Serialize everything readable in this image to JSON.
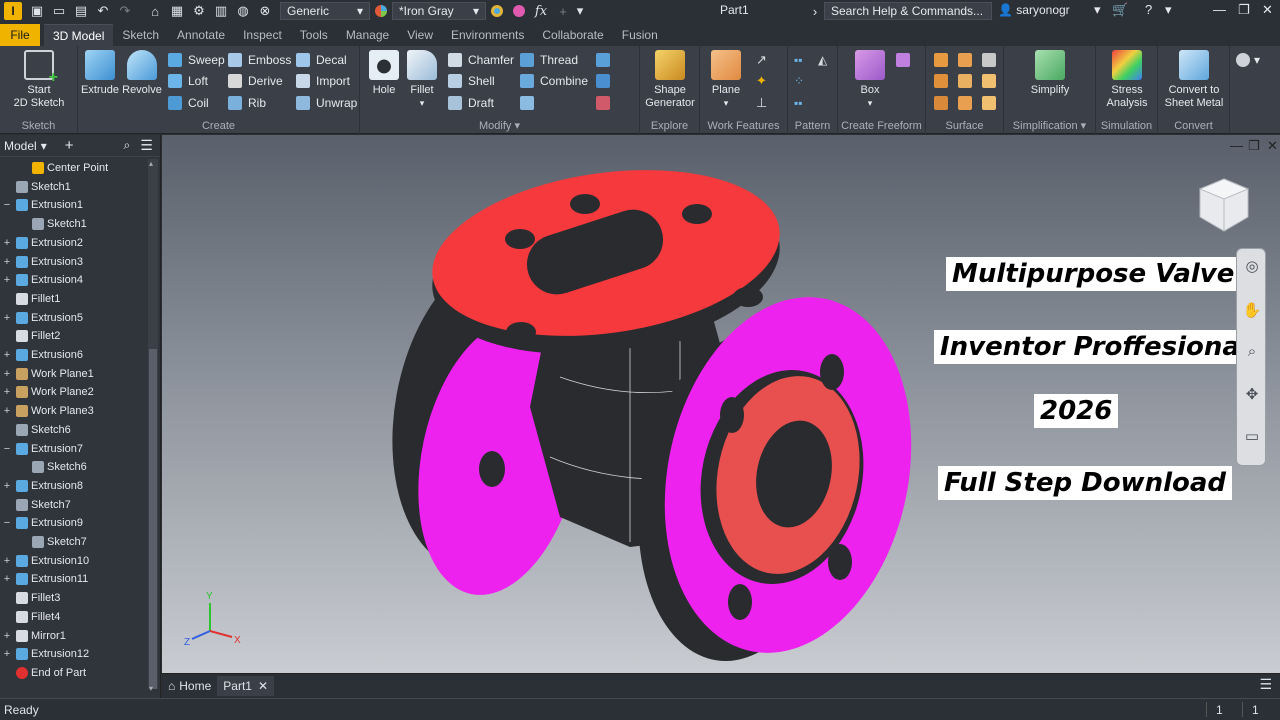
{
  "titlebar": {
    "app_icon": "I",
    "material_combo": "Generic",
    "appearance_combo": "*Iron Gray",
    "document_title": "Part1",
    "search_placeholder": "Search Help & Commands...",
    "user_name": "saryonogr"
  },
  "ribbon_tabs": [
    "File",
    "3D Model",
    "Sketch",
    "Annotate",
    "Inspect",
    "Tools",
    "Manage",
    "View",
    "Environments",
    "Collaborate",
    "Fusion"
  ],
  "active_tab": "3D Model",
  "ribbon": {
    "sketch_panel": {
      "label": "Sketch",
      "start_sketch": "Start\n2D Sketch"
    },
    "create_panel": {
      "label": "Create",
      "extrude": "Extrude",
      "revolve": "Revolve",
      "sweep": "Sweep",
      "loft": "Loft",
      "coil": "Coil",
      "emboss": "Emboss",
      "derive": "Derive",
      "rib": "Rib",
      "decal": "Decal",
      "import": "Import",
      "unwrap": "Unwrap"
    },
    "modify_panel": {
      "label": "Modify",
      "hole": "Hole",
      "fillet": "Fillet",
      "chamfer": "Chamfer",
      "shell": "Shell",
      "draft": "Draft",
      "thread": "Thread",
      "combine": "Combine"
    },
    "explore_panel": {
      "label": "Explore",
      "shape_generator": "Shape\nGenerator"
    },
    "work_features_panel": {
      "label": "Work Features",
      "plane": "Plane"
    },
    "pattern_panel": {
      "label": "Pattern"
    },
    "freeform_panel": {
      "label": "Create Freeform",
      "box": "Box"
    },
    "surface_panel": {
      "label": "Surface"
    },
    "simplification_panel": {
      "label": "Simplification",
      "simplify": "Simplify"
    },
    "simulation_panel": {
      "label": "Simulation",
      "stress": "Stress\nAnalysis"
    },
    "convert_panel": {
      "label": "Convert",
      "sheet_metal": "Convert to\nSheet Metal"
    }
  },
  "browser": {
    "title": "Model",
    "items": [
      {
        "label": "Center Point",
        "expander": "",
        "indent": 2,
        "icon": "point-icon"
      },
      {
        "label": "Sketch1",
        "expander": "",
        "indent": 1,
        "icon": "sketch-icon"
      },
      {
        "label": "Extrusion1",
        "expander": "−",
        "indent": 1,
        "icon": "extrude-icon"
      },
      {
        "label": "Sketch1",
        "expander": "",
        "indent": 2,
        "icon": "sketch-icon"
      },
      {
        "label": "Extrusion2",
        "expander": "+",
        "indent": 1,
        "icon": "extrude-icon"
      },
      {
        "label": "Extrusion3",
        "expander": "+",
        "indent": 1,
        "icon": "extrude-icon"
      },
      {
        "label": "Extrusion4",
        "expander": "+",
        "indent": 1,
        "icon": "extrude-icon"
      },
      {
        "label": "Fillet1",
        "expander": "",
        "indent": 1,
        "icon": "fillet-icon"
      },
      {
        "label": "Extrusion5",
        "expander": "+",
        "indent": 1,
        "icon": "extrude-icon"
      },
      {
        "label": "Fillet2",
        "expander": "",
        "indent": 1,
        "icon": "fillet-icon"
      },
      {
        "label": "Extrusion6",
        "expander": "+",
        "indent": 1,
        "icon": "extrude-icon"
      },
      {
        "label": "Work Plane1",
        "expander": "+",
        "indent": 1,
        "icon": "workplane-icon"
      },
      {
        "label": "Work Plane2",
        "expander": "+",
        "indent": 1,
        "icon": "workplane-icon"
      },
      {
        "label": "Work Plane3",
        "expander": "+",
        "indent": 1,
        "icon": "workplane-icon"
      },
      {
        "label": "Sketch6",
        "expander": "",
        "indent": 1,
        "icon": "sketch-icon"
      },
      {
        "label": "Extrusion7",
        "expander": "−",
        "indent": 1,
        "icon": "extrude-icon"
      },
      {
        "label": "Sketch6",
        "expander": "",
        "indent": 2,
        "icon": "sketch-icon"
      },
      {
        "label": "Extrusion8",
        "expander": "+",
        "indent": 1,
        "icon": "extrude-icon"
      },
      {
        "label": "Sketch7",
        "expander": "",
        "indent": 1,
        "icon": "sketch-icon"
      },
      {
        "label": "Extrusion9",
        "expander": "−",
        "indent": 1,
        "icon": "extrude-icon"
      },
      {
        "label": "Sketch7",
        "expander": "",
        "indent": 2,
        "icon": "sketch-icon"
      },
      {
        "label": "Extrusion10",
        "expander": "+",
        "indent": 1,
        "icon": "extrude-icon"
      },
      {
        "label": "Extrusion11",
        "expander": "+",
        "indent": 1,
        "icon": "extrude-icon"
      },
      {
        "label": "Fillet3",
        "expander": "",
        "indent": 1,
        "icon": "fillet-icon"
      },
      {
        "label": "Fillet4",
        "expander": "",
        "indent": 1,
        "icon": "fillet-icon"
      },
      {
        "label": "Mirror1",
        "expander": "+",
        "indent": 1,
        "icon": "mirror-icon"
      },
      {
        "label": "Extrusion12",
        "expander": "+",
        "indent": 1,
        "icon": "extrude-icon"
      },
      {
        "label": "End of Part",
        "expander": "",
        "indent": 1,
        "icon": "end-of-part-icon"
      }
    ]
  },
  "viewport": {
    "overlay_lines": [
      "Multipurpose Valve",
      "Inventor Proffesional",
      "2026",
      "Full Step Download"
    ],
    "axis_labels": {
      "x": "X",
      "y": "Y",
      "z": "Z"
    },
    "colors": {
      "flange_top": "#f5393c",
      "flange_side": "#ee22ee",
      "body": "#2a2b2e",
      "face_ring": "#e85050"
    }
  },
  "doc_tabs": {
    "home": "Home",
    "part": "Part1"
  },
  "status": {
    "text": "Ready",
    "count1": "1",
    "count2": "1"
  }
}
